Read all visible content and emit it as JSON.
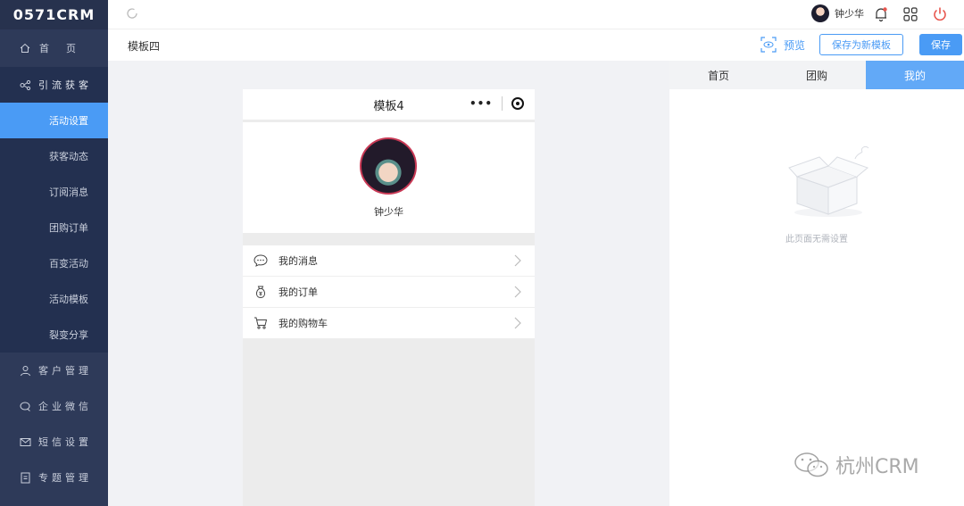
{
  "app": {
    "logo": "0571CRM"
  },
  "sidebar": {
    "home": {
      "label": "首  页",
      "icon": "home-icon"
    },
    "groups": [
      {
        "label": "引流获客",
        "icon": "share-icon",
        "items": [
          {
            "label": "活动设置",
            "active": true
          },
          {
            "label": "获客动态"
          },
          {
            "label": "订阅消息"
          },
          {
            "label": "团购订单"
          },
          {
            "label": "百变活动"
          },
          {
            "label": "活动模板"
          },
          {
            "label": "裂变分享"
          }
        ]
      }
    ],
    "sections": [
      {
        "label": "客户管理",
        "icon": "user-icon"
      },
      {
        "label": "企业微信",
        "icon": "chat-icon"
      },
      {
        "label": "短信设置",
        "icon": "mail-icon"
      },
      {
        "label": "专题管理",
        "icon": "document-icon"
      }
    ]
  },
  "header": {
    "user_name": "钟少华",
    "icons": [
      "refresh-icon",
      "bell-icon",
      "grid-icon",
      "power-icon"
    ]
  },
  "subheader": {
    "template_name": "模板四",
    "preview_label": "预览",
    "save_as_new_label": "保存为新模板",
    "save_label": "保存"
  },
  "phone": {
    "title": "模板4",
    "capsule_dots": "•••",
    "profile_name": "钟少华",
    "menu": [
      {
        "label": "我的消息",
        "icon": "message-icon"
      },
      {
        "label": "我的订单",
        "icon": "money-bag-icon"
      },
      {
        "label": "我的购物车",
        "icon": "cart-icon"
      }
    ]
  },
  "right_panel": {
    "tabs": [
      {
        "label": "首页"
      },
      {
        "label": "团购"
      },
      {
        "label": "我的",
        "active": true
      }
    ],
    "empty_text": "此页面无需设置"
  },
  "watermark": {
    "text": "杭州CRM"
  },
  "colors": {
    "primary": "#4a9bf5",
    "sidebar": "#2e3a59",
    "danger": "#e8564e"
  }
}
